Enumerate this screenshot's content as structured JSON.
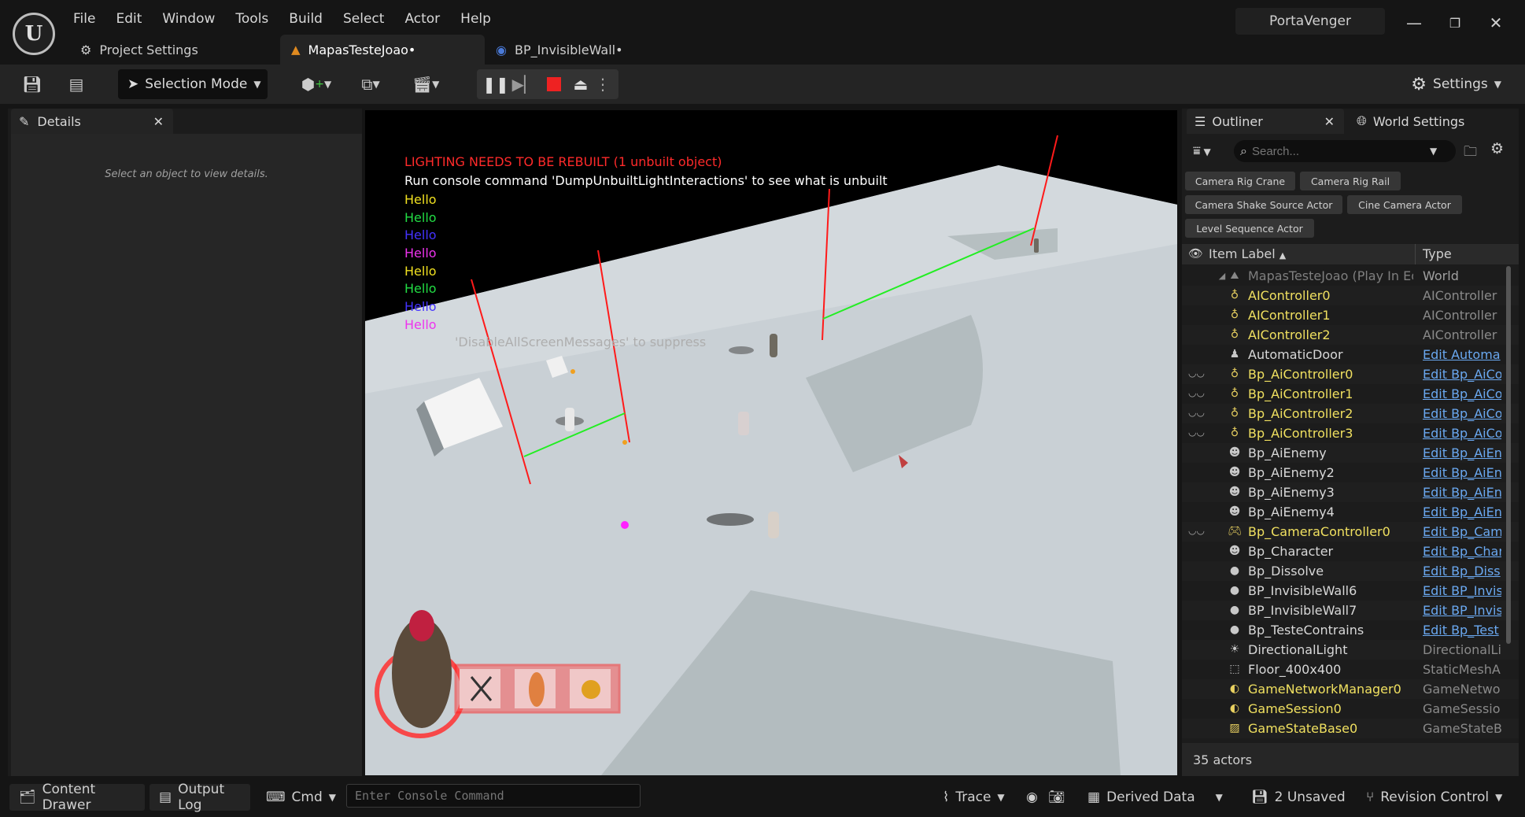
{
  "menu": [
    "File",
    "Edit",
    "Window",
    "Tools",
    "Build",
    "Select",
    "Actor",
    "Help"
  ],
  "tabs": [
    {
      "label": "Project Settings"
    },
    {
      "label": "MapasTesteJoao•"
    },
    {
      "label": "BP_InvisibleWall•"
    }
  ],
  "project_name": "PortaVenger",
  "toolbar": {
    "selection_mode": "Selection Mode",
    "settings": "Settings"
  },
  "details": {
    "tab": "Details",
    "empty_text": "Select an object to view details."
  },
  "viewport": {
    "messages": [
      {
        "text": "LIGHTING NEEDS TO BE REBUILT (1 unbuilt object)",
        "color": "#ff2a2a"
      },
      {
        "text": "Run console command 'DumpUnbuiltLightInteractions' to see what is unbuilt",
        "color": "#ffffff"
      },
      {
        "text": "Hello",
        "color": "#f0e020"
      },
      {
        "text": "Hello",
        "color": "#22dd44"
      },
      {
        "text": "Hello",
        "color": "#4433ff"
      },
      {
        "text": "Hello",
        "color": "#ee33ee"
      },
      {
        "text": "Hello",
        "color": "#f0e020"
      },
      {
        "text": "Hello",
        "color": "#22dd44"
      },
      {
        "text": "Hello",
        "color": "#4433ff"
      },
      {
        "text": "Hello",
        "color": "#ee33ee"
      }
    ],
    "suppress_text": "'DisableAllScreenMessages' to suppress"
  },
  "outliner": {
    "tab": "Outliner",
    "world_settings_tab": "World Settings",
    "search_placeholder": "Search...",
    "chips": [
      "Camera Rig Crane",
      "Camera Rig Rail",
      "Camera Shake Source Actor",
      "Cine Camera Actor",
      "Level Sequence Actor"
    ],
    "col_label": "Item Label",
    "col_type": "Type",
    "root": {
      "label": "MapasTesteJoao (Play In Ed",
      "type": "World"
    },
    "rows": [
      {
        "label": "AIController0",
        "type": "AIController",
        "color": "yellow",
        "link": false,
        "eye": false,
        "icon": "controller-icon"
      },
      {
        "label": "AIController1",
        "type": "AIController",
        "color": "yellow",
        "link": false,
        "eye": false,
        "icon": "controller-icon"
      },
      {
        "label": "AIController2",
        "type": "AIController",
        "color": "yellow",
        "link": false,
        "eye": false,
        "icon": "controller-icon"
      },
      {
        "label": "AutomaticDoor",
        "type": "Edit Automa",
        "color": "white",
        "link": true,
        "eye": false,
        "icon": "actor-icon"
      },
      {
        "label": "Bp_AiController0",
        "type": "Edit Bp_AiCo",
        "color": "yellow",
        "link": true,
        "eye": true,
        "icon": "controller-icon"
      },
      {
        "label": "Bp_AiController1",
        "type": "Edit Bp_AiCo",
        "color": "yellow",
        "link": true,
        "eye": true,
        "icon": "controller-icon"
      },
      {
        "label": "Bp_AiController2",
        "type": "Edit Bp_AiCo",
        "color": "yellow",
        "link": true,
        "eye": true,
        "icon": "controller-icon"
      },
      {
        "label": "Bp_AiController3",
        "type": "Edit Bp_AiCo",
        "color": "yellow",
        "link": true,
        "eye": true,
        "icon": "controller-icon"
      },
      {
        "label": "Bp_AiEnemy",
        "type": "Edit Bp_AiEn",
        "color": "white",
        "link": true,
        "eye": false,
        "icon": "pawn-icon"
      },
      {
        "label": "Bp_AiEnemy2",
        "type": "Edit Bp_AiEn",
        "color": "white",
        "link": true,
        "eye": false,
        "icon": "pawn-icon"
      },
      {
        "label": "Bp_AiEnemy3",
        "type": "Edit Bp_AiEn",
        "color": "white",
        "link": true,
        "eye": false,
        "icon": "pawn-icon"
      },
      {
        "label": "Bp_AiEnemy4",
        "type": "Edit Bp_AiEn",
        "color": "white",
        "link": true,
        "eye": false,
        "icon": "pawn-icon"
      },
      {
        "label": "Bp_CameraController0",
        "type": "Edit Bp_Cam",
        "color": "yellow",
        "link": true,
        "eye": true,
        "icon": "gamepad-icon"
      },
      {
        "label": "Bp_Character",
        "type": "Edit Bp_Char",
        "color": "white",
        "link": true,
        "eye": false,
        "icon": "pawn-icon"
      },
      {
        "label": "Bp_Dissolve",
        "type": "Edit Bp_Diss",
        "color": "white",
        "link": true,
        "eye": false,
        "icon": "sphere-icon"
      },
      {
        "label": "BP_InvisibleWall6",
        "type": "Edit BP_Invis",
        "color": "white",
        "link": true,
        "eye": false,
        "icon": "sphere-icon"
      },
      {
        "label": "BP_InvisibleWall7",
        "type": "Edit BP_Invis",
        "color": "white",
        "link": true,
        "eye": false,
        "icon": "sphere-icon"
      },
      {
        "label": "Bp_TesteContrains",
        "type": "Edit Bp_Test",
        "color": "white",
        "link": true,
        "eye": false,
        "icon": "sphere-icon"
      },
      {
        "label": "DirectionalLight",
        "type": "DirectionalLi",
        "color": "white",
        "link": false,
        "eye": false,
        "icon": "sun-icon"
      },
      {
        "label": "Floor_400x400",
        "type": "StaticMeshA",
        "color": "white",
        "link": false,
        "eye": false,
        "icon": "cube-icon"
      },
      {
        "label": "GameNetworkManager0",
        "type": "GameNetwo",
        "color": "yellow",
        "link": false,
        "eye": false,
        "icon": "globe-icon"
      },
      {
        "label": "GameSession0",
        "type": "GameSessio",
        "color": "yellow",
        "link": false,
        "eye": false,
        "icon": "globe-icon"
      },
      {
        "label": "GameStateBase0",
        "type": "GameStateB",
        "color": "yellow",
        "link": false,
        "eye": false,
        "icon": "chart-icon"
      }
    ],
    "actor_count": "35 actors"
  },
  "statusbar": {
    "content_drawer": "Content Drawer",
    "output_log": "Output Log",
    "cmd": "Cmd",
    "console_placeholder": "Enter Console Command",
    "trace": "Trace",
    "derived_data": "Derived Data",
    "unsaved": "2 Unsaved",
    "revision_control": "Revision Control"
  }
}
